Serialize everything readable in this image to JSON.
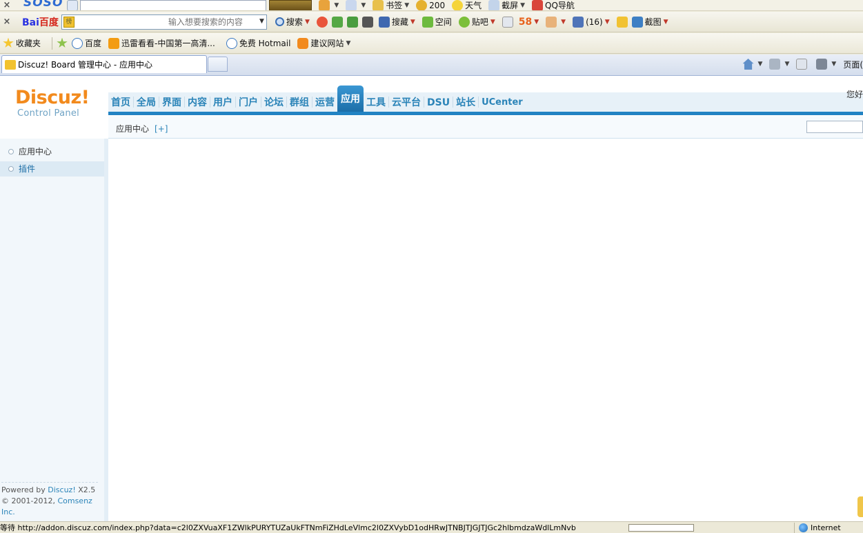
{
  "browser": {
    "soso_bar": {
      "logo": "SOSO",
      "items": [
        {
          "label": "书签"
        },
        {
          "label": "200"
        },
        {
          "label": "天气"
        },
        {
          "label": "截屏"
        },
        {
          "label": "QQ导航"
        }
      ]
    },
    "baidu_bar": {
      "logo_prefix": "Bai",
      "logo_suffix": "百度",
      "search_placeholder": "输入想要搜索的内容",
      "search_button": "搜索",
      "items": [
        {
          "label": "搜藏"
        },
        {
          "label": "空间"
        },
        {
          "label": "贴吧"
        },
        {
          "label": "58"
        },
        {
          "label": "(16)"
        },
        {
          "label": "截图"
        }
      ]
    },
    "favorites_bar": {
      "favorites_label": "收藏夹",
      "links": [
        {
          "label": "百度"
        },
        {
          "label": "迅雷看看-中国第一高清..."
        },
        {
          "label": "免费 Hotmail"
        },
        {
          "label": "建议网站"
        }
      ]
    },
    "tab": {
      "title": "Discuz! Board 管理中心 - 应用中心"
    },
    "command_bar": {
      "page_label": "页面("
    }
  },
  "app": {
    "logo": {
      "main": "Discuz!",
      "sub": "Control Panel"
    },
    "greeting": "您好",
    "nav": [
      {
        "label": "首页"
      },
      {
        "label": "全局"
      },
      {
        "label": "界面"
      },
      {
        "label": "内容"
      },
      {
        "label": "用户"
      },
      {
        "label": "门户"
      },
      {
        "label": "论坛"
      },
      {
        "label": "群组"
      },
      {
        "label": "运营"
      },
      {
        "label": "应用",
        "active": true
      },
      {
        "label": "工具"
      },
      {
        "label": "云平台"
      },
      {
        "label": "DSU"
      },
      {
        "label": "站长"
      },
      {
        "label": "UCenter"
      }
    ],
    "breadcrumb": {
      "label": "应用中心",
      "add": "[+]"
    },
    "sidebar": {
      "items": [
        {
          "label": "应用中心",
          "active": false
        },
        {
          "label": "插件",
          "active": true
        }
      ],
      "powered_prefix": "Powered by ",
      "powered_link": "Discuz!",
      "powered_version": " X2.5",
      "copyright_prefix": "© 2001-2012, ",
      "copyright_link": "Comsenz Inc."
    }
  },
  "statusbar": {
    "text": "等待 http://addon.discuz.com/index.php?data=c2l0ZXVuaXF1ZWlkPURYTUZaUkFTNmFiZHdLeVlmc2l0ZXVybD1odHRwJTNBJTJGJTJGc2hlbmdzaWdlLmNvb",
    "zone": "Internet"
  },
  "colors": {
    "nav_text": "#2b84b8",
    "nav_active_bg": "#1c6ea8",
    "logo_orange": "#f28a1d",
    "accent_line": "#2283c3"
  }
}
